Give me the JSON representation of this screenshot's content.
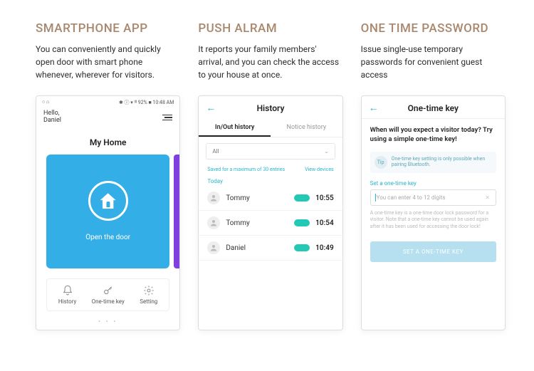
{
  "features": [
    {
      "title": "SMARTPHONE APP",
      "desc": "You can conveniently and quickly open door with smart phone whenever, wherever for visitors."
    },
    {
      "title": "PUSH ALRAM",
      "desc": "It reports your family members' arrival, and you can check the access to your house at once."
    },
    {
      "title": "ONE TIME PASSWORD",
      "desc": "Issue single-use temporary passwords for convenient guest access"
    }
  ],
  "phone1": {
    "status_left": "○ ⌂",
    "status_right": "✱ ⓘ ▾ ᴵᴵᴵ 92% ■ 10:48 AM",
    "greeting": "Hello,",
    "username": "Daniel",
    "home_title": "My Home",
    "open_label": "Open the door",
    "tabs": {
      "history": "History",
      "otk": "One-time key",
      "setting": "Setting"
    },
    "dots": "• • •"
  },
  "phone2": {
    "title": "History",
    "tab_inout": "In/Out history",
    "tab_notice": "Notice history",
    "filter": "All",
    "meta_left": "Saved for a maximum of 30 entries",
    "meta_right": "View devices",
    "today": "Today",
    "rows": [
      {
        "name": "Tommy",
        "time": "10:55"
      },
      {
        "name": "Tommy",
        "time": "10:54"
      },
      {
        "name": "Daniel",
        "time": "10:49"
      }
    ]
  },
  "phone3": {
    "title": "One-time key",
    "question": "When will you expect a visitor today? Try using a simple one-time key!",
    "tip_badge": "Tip",
    "tip_text": "One-time key setting is only possible when pairing Bluetooth.",
    "set_label": "Set a one-time key",
    "placeholder": "You can enter 4 to 12 digits",
    "note": "A one-time key is a one-time door lock password for a visitor. Note that a one-time key cannot be used again after it has been used for accessing the door lock!",
    "button": "SET A ONE-TIME KEY"
  }
}
